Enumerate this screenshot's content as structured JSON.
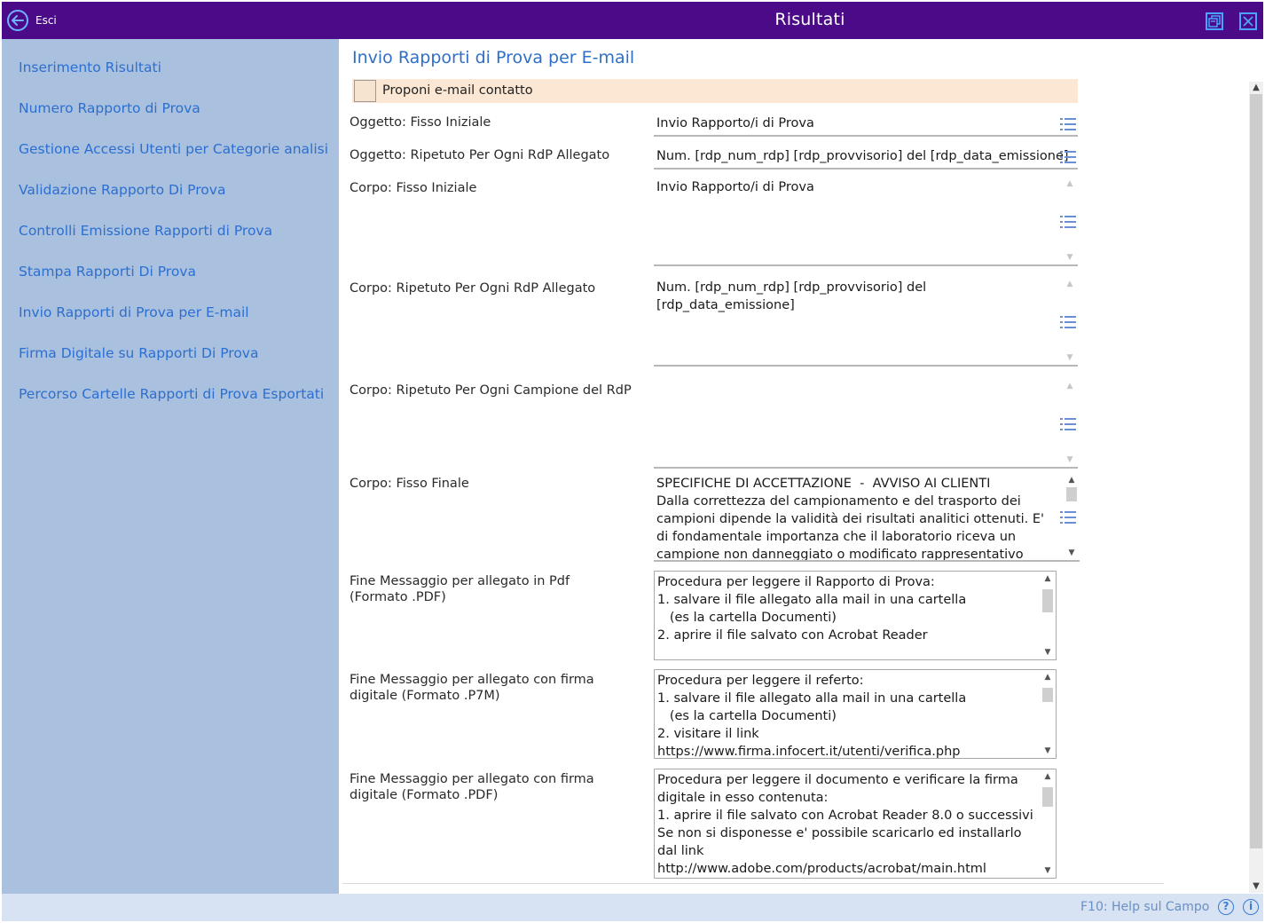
{
  "window": {
    "title": "Risultati",
    "exit_label": "Esci",
    "accent_color": "#4b0a88"
  },
  "sidebar": {
    "items": [
      {
        "label": "Inserimento Risultati"
      },
      {
        "label": "Numero Rapporto di Prova"
      },
      {
        "label": "Gestione Accessi Utenti per Categorie analisi"
      },
      {
        "label": "Validazione Rapporto Di Prova"
      },
      {
        "label": "Controlli  Emissione Rapporti di Prova"
      },
      {
        "label": "Stampa Rapporti Di Prova"
      },
      {
        "label": "Invio Rapporti di Prova per E-mail"
      },
      {
        "label": "Firma Digitale su Rapporti Di Prova"
      },
      {
        "label": "Percorso Cartelle Rapporti di Prova Esportati"
      }
    ]
  },
  "main": {
    "section_title": "Invio Rapporti di Prova per E-mail",
    "propose_email": {
      "label": "Proponi e-mail contatto",
      "checked": false
    },
    "fields": {
      "subject_initial": {
        "label": "Oggetto: Fisso Iniziale",
        "value": "Invio Rapporto/i di Prova"
      },
      "subject_repeated": {
        "label": "Oggetto: Ripetuto Per Ogni RdP Allegato",
        "value": "Num. [rdp_num_rdp] [rdp_provvisorio] del [rdp_data_emissione]"
      },
      "body_initial": {
        "label": "Corpo: Fisso Iniziale",
        "value": "Invio Rapporto/i di Prova"
      },
      "body_repeated_rdp": {
        "label": "Corpo: Ripetuto Per Ogni RdP Allegato",
        "value": "Num. [rdp_num_rdp] [rdp_provvisorio] del\n[rdp_data_emissione]"
      },
      "body_repeated_sample": {
        "label": "Corpo: Ripetuto Per Ogni Campione del RdP",
        "value": ""
      },
      "body_final": {
        "label": "Corpo: Fisso Finale",
        "value": "SPECIFICHE DI ACCETTAZIONE  -  AVVISO AI CLIENTI\nDalla correttezza del campionamento e del trasporto dei campioni dipende la validità dei risultati analitici ottenuti. E' di fondamentale importanza che il laboratorio riceva un campione non danneggiato o modificato rappresentativo"
      },
      "end_msg_pdf": {
        "label": "Fine Messaggio per allegato in Pdf\n(Formato .PDF)",
        "value": "Procedura per leggere il Rapporto di Prova:\n1. salvare il file allegato alla mail in una cartella\n   (es la cartella Documenti)\n2. aprire il file salvato con Acrobat Reader"
      },
      "end_msg_p7m": {
        "label": "Fine Messaggio per allegato con firma\ndigitale (Formato .P7M)",
        "value": "Procedura per leggere il referto:\n1. salvare il file allegato alla mail in una cartella\n   (es la cartella Documenti)\n2. visitare il link\nhttps://www.firma.infocert.it/utenti/verifica.php"
      },
      "end_msg_signed_pdf": {
        "label": "Fine Messaggio per allegato con firma\ndigitale (Formato .PDF)",
        "value": "Procedura per leggere il documento e verificare la firma digitale in esso contenuta:\n1. aprire il file salvato con Acrobat Reader 8.0 o successivi\nSe non si disponesse e' possibile scaricarlo ed installarlo dal link\nhttp://www.adobe.com/products/acrobat/main.html"
      }
    }
  },
  "statusbar": {
    "help_text": "F10: Help sul Campo"
  },
  "icons": {
    "exit": "back-arrow-icon",
    "restore": "restore-window-icon",
    "close": "close-icon",
    "list": "list-icon",
    "help": "help-icon",
    "info": "info-icon"
  }
}
